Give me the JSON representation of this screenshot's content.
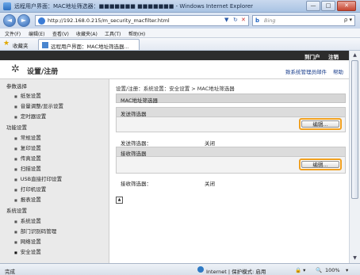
{
  "window": {
    "title": "远程用户界面：MAC地址筛选器：■■■■■■■ ■■■■■■■ - Windows Internet Explorer",
    "minimize": "—",
    "maximize": "□",
    "close": "✕"
  },
  "address": {
    "back": "◄",
    "forward": "►",
    "url": "http://192.168.0.215/m_security_macfilter.html",
    "refresh": "↻",
    "stop": "✕",
    "dropdown": "▼",
    "search_placeholder": "Bing",
    "search_go": "ρ ▾"
  },
  "menu": [
    "文件(F)",
    "编辑(E)",
    "查看(V)",
    "收藏夹(A)",
    "工具(T)",
    "帮助(H)"
  ],
  "favorites": {
    "label": "收藏夹",
    "tab": "远程用户界面：MAC地址筛选器..."
  },
  "topstrip": {
    "portal": "到门户",
    "logout": "注销"
  },
  "header": {
    "title": "设置/注册",
    "admin_mail": "致系统管理员邮件",
    "help": "帮助"
  },
  "sidebar": {
    "sections": [
      {
        "label": "参数选择",
        "items": [
          "纸张设置",
          "音量调整/显示设置",
          "定时器设置"
        ]
      },
      {
        "label": "功能设置",
        "items": [
          "常规设置",
          "复印设置",
          "传真设置",
          "扫描设置",
          "USB直接打印设置",
          "打印机设置",
          "报表设置"
        ]
      },
      {
        "label": "系统设置",
        "items": [
          "系统设置",
          "部门识别码管理",
          "网络设置",
          "安全设置"
        ]
      }
    ]
  },
  "content": {
    "breadcrumb": "设置/注册：系统设置：安全设置 > MAC地址筛选器",
    "page_title": "MAC地址筛选器",
    "send_filter": {
      "heading": "发送筛选器",
      "edit_button": "编辑...",
      "label": "发送筛选器：",
      "value": "关闭"
    },
    "receive_filter": {
      "heading": "接收筛选器",
      "edit_button": "编辑...",
      "label": "接收筛选器：",
      "value": "关闭"
    },
    "top_icon": "▲"
  },
  "status": {
    "left": "完成",
    "zone": "Internet | 保护模式: 启用",
    "zoom": "100%"
  }
}
